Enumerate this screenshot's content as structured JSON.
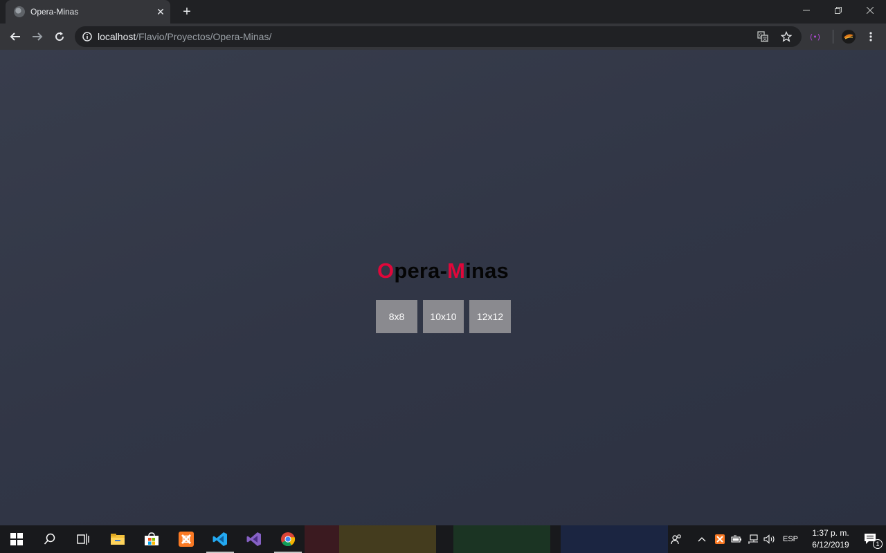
{
  "browser": {
    "tab": {
      "title": "Opera-Minas",
      "close": "✕"
    },
    "new_tab": "+",
    "url": {
      "host": "localhost",
      "path": "/Flavio/Proyectos/Opera-Minas/"
    }
  },
  "page": {
    "title": {
      "first_letter": "O",
      "part1": "pera-",
      "second_letter": "M",
      "part2": "inas",
      "accent_color": "#e0073a"
    },
    "size_buttons": [
      "8x8",
      "10x10",
      "12x12"
    ]
  },
  "taskbar": {
    "language": "ESP",
    "time": "1:37 p. m.",
    "date": "6/12/2019",
    "notifications_count": "1",
    "apps": [
      "start-icon",
      "search-icon",
      "task-view-icon",
      "file-explorer-icon",
      "store-icon",
      "xampp-icon",
      "vscode-icon",
      "visual-studio-icon",
      "chrome-icon"
    ]
  }
}
